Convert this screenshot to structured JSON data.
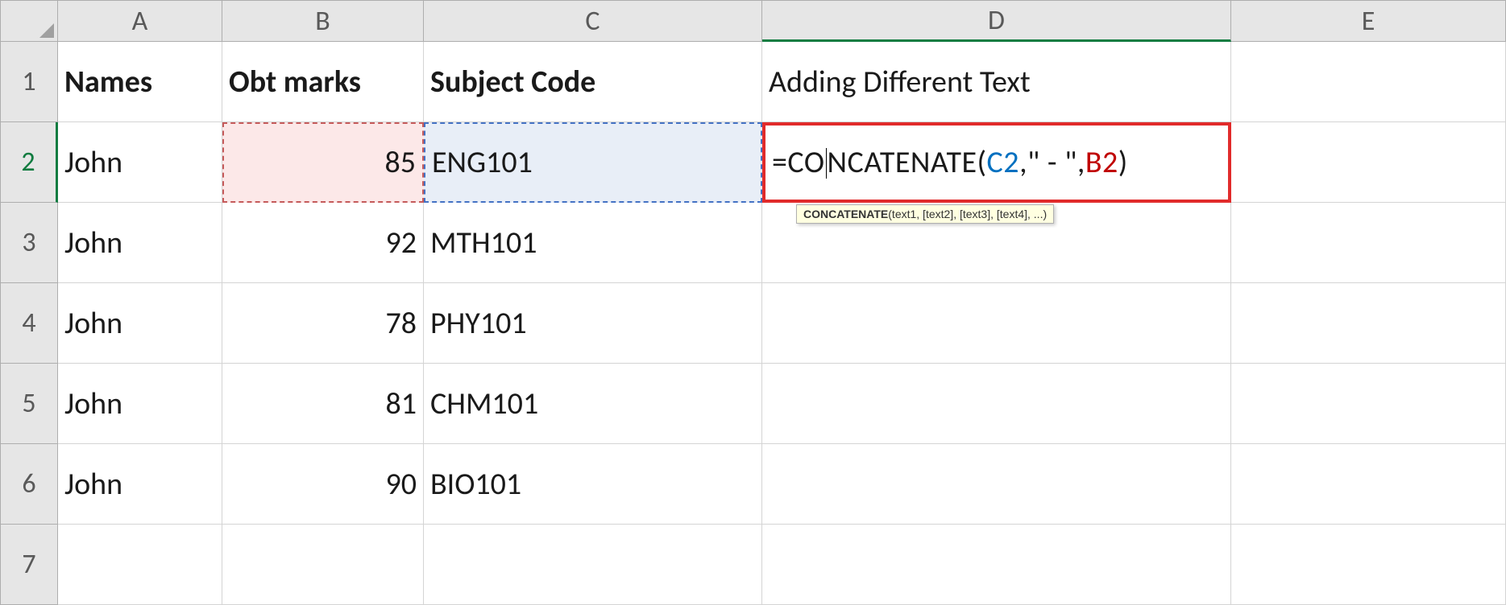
{
  "columns": [
    "A",
    "B",
    "C",
    "D",
    "E"
  ],
  "row_numbers": [
    "1",
    "2",
    "3",
    "4",
    "5",
    "6",
    "7"
  ],
  "headers": {
    "A": "Names",
    "B": "Obt marks",
    "C": "Subject Code",
    "D": "Adding Different Text"
  },
  "rows": [
    {
      "name": "John",
      "marks": "85",
      "code": "ENG101"
    },
    {
      "name": "John",
      "marks": "92",
      "code": "MTH101"
    },
    {
      "name": "John",
      "marks": "78",
      "code": "PHY101"
    },
    {
      "name": "John",
      "marks": "81",
      "code": "CHM101"
    },
    {
      "name": "John",
      "marks": "90",
      "code": "BIO101"
    }
  ],
  "formula": {
    "pre": "=CO",
    "post": "NCATENATE(",
    "ref1": "C2",
    "mid": ",\" - \",",
    "ref2": "B2",
    "end": ")"
  },
  "tooltip": {
    "name": "CONCATENATE",
    "args": "(text1, [text2], [text3], [text4], ...)"
  }
}
